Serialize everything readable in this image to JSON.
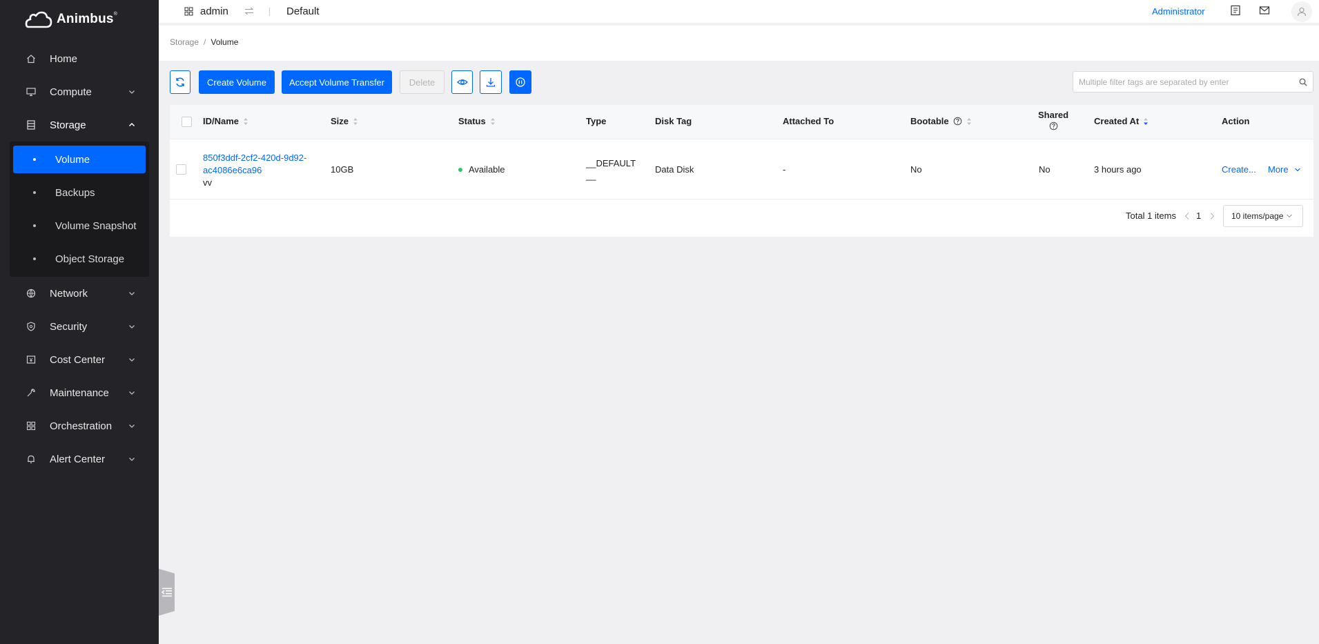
{
  "brand": {
    "name": "Animbus",
    "mark": "®"
  },
  "sidebar": {
    "items": [
      {
        "label": "Home",
        "icon": "home-icon"
      },
      {
        "label": "Compute",
        "icon": "monitor-icon"
      },
      {
        "label": "Storage",
        "icon": "storage-icon"
      },
      {
        "label": "Network",
        "icon": "globe-icon"
      },
      {
        "label": "Security",
        "icon": "shield-icon"
      },
      {
        "label": "Cost Center",
        "icon": "cost-icon"
      },
      {
        "label": "Maintenance",
        "icon": "wrench-icon"
      },
      {
        "label": "Orchestration",
        "icon": "grid-icon"
      },
      {
        "label": "Alert Center",
        "icon": "bell-icon"
      }
    ],
    "storage_children": [
      "Volume",
      "Backups",
      "Volume Snapshot",
      "Object Storage"
    ],
    "active_child": "Volume"
  },
  "header": {
    "project": "admin",
    "domain": "Default",
    "user_role": "Administrator"
  },
  "breadcrumb": {
    "parent": "Storage",
    "separator": "/",
    "current": "Volume"
  },
  "toolbar": {
    "create_label": "Create Volume",
    "accept_label": "Accept Volume Transfer",
    "delete_label": "Delete",
    "search_placeholder": "Multiple filter tags are separated by enter"
  },
  "table": {
    "columns": {
      "id_name": "ID/Name",
      "size": "Size",
      "status": "Status",
      "type": "Type",
      "disk_tag": "Disk Tag",
      "attached_to": "Attached To",
      "bootable": "Bootable",
      "shared": "Shared",
      "created_at": "Created At",
      "action": "Action"
    },
    "rows": [
      {
        "id_line1": "850f3ddf-2cf2-420d-9d92-",
        "id_line2": "ac4086e6ca96",
        "name": "vv",
        "size": "10GB",
        "status": "Available",
        "type_line1": "__DEFAULT",
        "type_line2": "__",
        "disk_tag": "Data Disk",
        "attached_to": "-",
        "bootable": "No",
        "shared": "No",
        "created_at": "3 hours ago",
        "action_primary": "Create...",
        "action_more": "More"
      }
    ]
  },
  "pagination": {
    "total": "Total 1 items",
    "current_page": "1",
    "page_size": "10 items/page"
  },
  "colors": {
    "accent": "#0068ff",
    "sidebar_bg": "#242428",
    "status_ok": "#33c46b"
  }
}
